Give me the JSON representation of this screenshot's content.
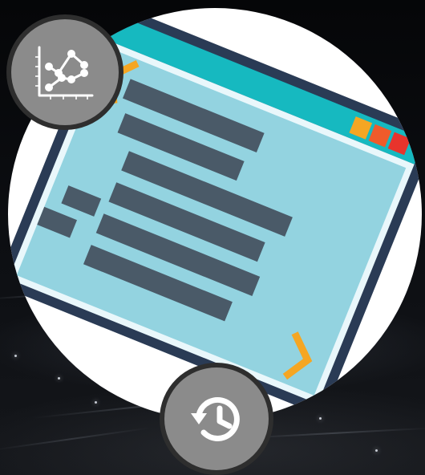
{
  "scene": {
    "background_color": "#07080b",
    "disc_color": "#ffffff"
  },
  "illustration": {
    "icon": "code-window-illustration",
    "frame_color": "#2a3b55",
    "title_bar_color": "#16b9c0",
    "screen_color": "#93d3e0",
    "line_color": "#4a5a68",
    "bracket_color": "#f5a623",
    "window_controls": [
      "#f5a623",
      "#ef5b2b",
      "#e8342c"
    ]
  },
  "buttons": {
    "chart": {
      "icon": "line-chart-icon",
      "fill": "#8b8b8b",
      "border": "#2e2e2e"
    },
    "history": {
      "icon": "history-clock-icon",
      "fill": "#8b8b8b",
      "border": "#2e2e2e"
    }
  }
}
